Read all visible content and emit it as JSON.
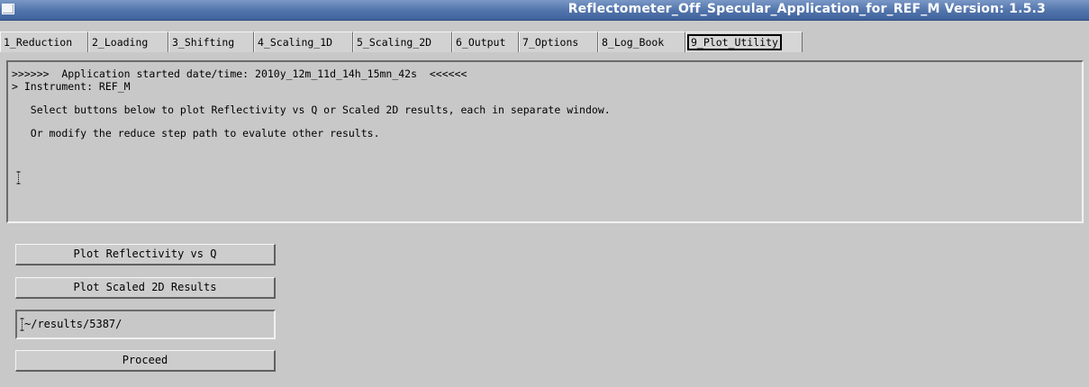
{
  "window": {
    "title": "Reflectometer_Off_Specular_Application_for_REF_M Version: 1.5.3"
  },
  "tabs": [
    {
      "label": "1_Reduction"
    },
    {
      "label": "2_Loading"
    },
    {
      "label": "3_Shifting"
    },
    {
      "label": "4_Scaling_1D"
    },
    {
      "label": "5_Scaling_2D"
    },
    {
      "label": "6_Output"
    },
    {
      "label": "7_Options"
    },
    {
      "label": "8_Log_Book"
    },
    {
      "label": "9_Plot_Utility"
    }
  ],
  "active_tab": "9_Plot_Utility",
  "log": {
    "lines": [
      ">>>>>>  Application started date/time: 2010y_12m_11d_14h_15mn_42s  <<<<<<",
      "> Instrument: REF_M",
      "",
      "   Select buttons below to plot Reflectivity vs Q or Scaled 2D results, each in separate window.",
      "",
      "   Or modify the reduce step path to evalute other results."
    ]
  },
  "buttons": {
    "plot_reflectivity": "Plot Reflectivity vs Q",
    "plot_scaled_2d": "Plot Scaled 2D Results",
    "proceed": "Proceed"
  },
  "path_field": {
    "value": "~/results/5387/"
  }
}
